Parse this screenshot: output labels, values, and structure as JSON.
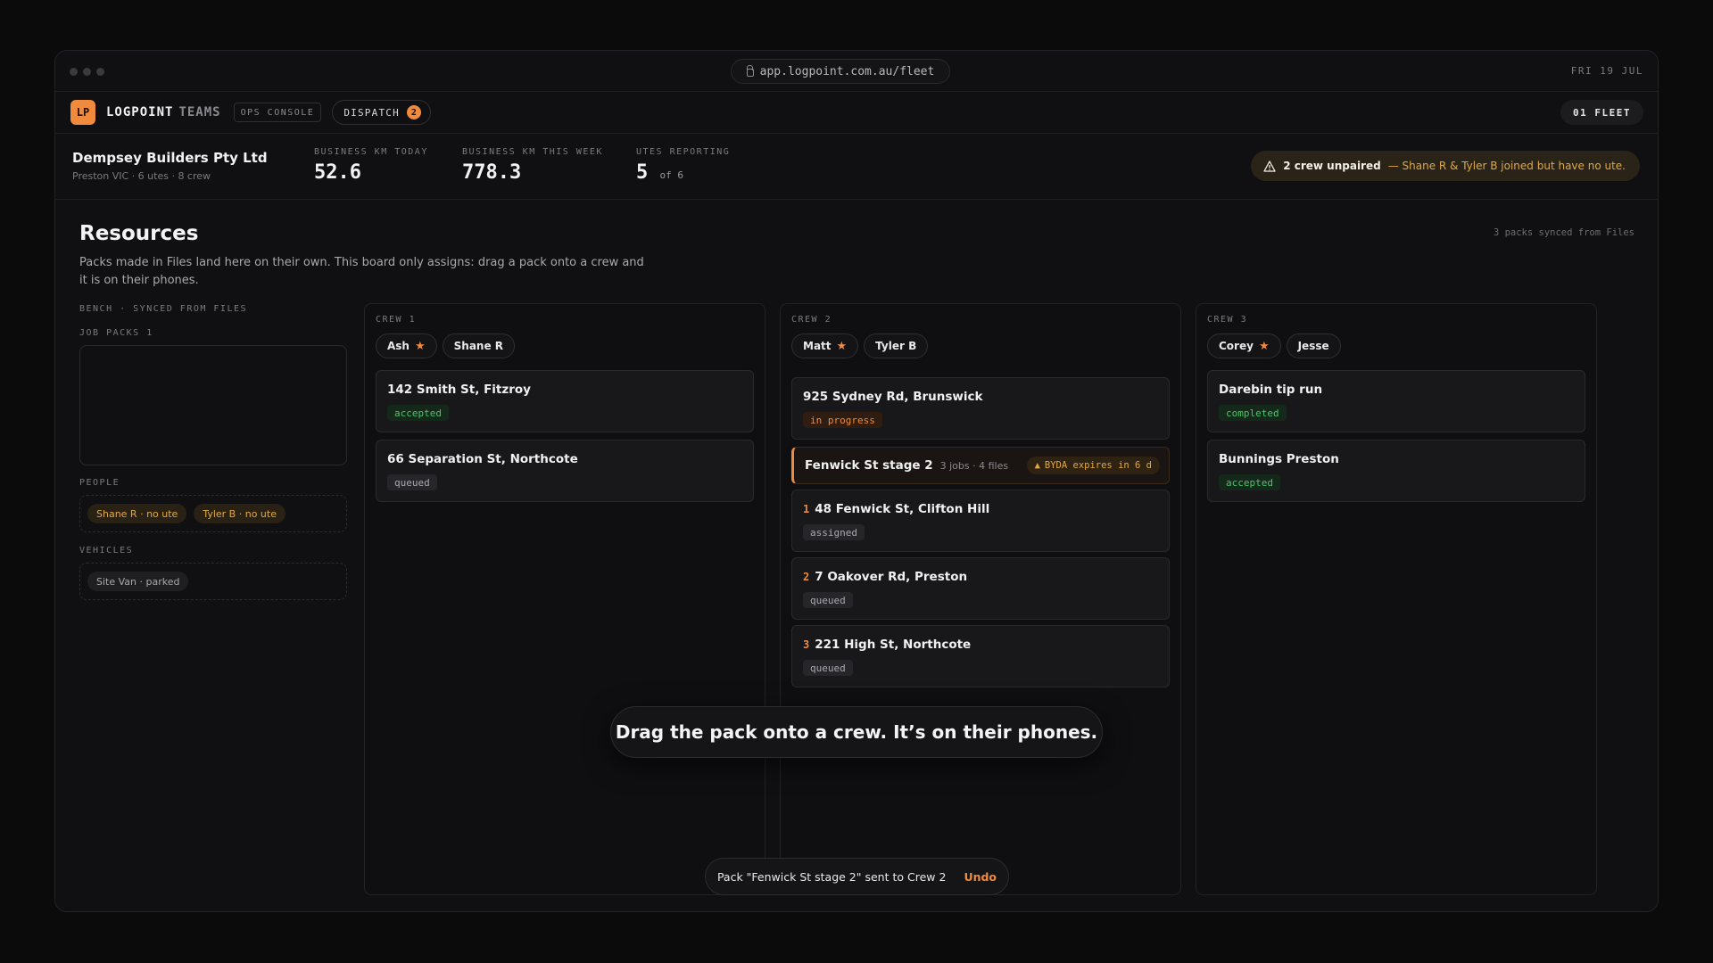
{
  "window": {
    "url": "app.logpoint.com.au/fleet",
    "date": "FRI 19 JUL"
  },
  "appbar": {
    "logo": "LP",
    "brand": "LOGPOINT",
    "brand_sub": "TEAMS",
    "ops_console": "OPS CONSOLE",
    "dispatch_label": "DISPATCH",
    "dispatch_count": "2",
    "fleet": "01 FLEET"
  },
  "company": {
    "name": "Dempsey Builders Pty Ltd",
    "sub": "Preston VIC · 6 utes · 8 crew"
  },
  "stats": [
    {
      "label": "BUSINESS KM TODAY",
      "value": "52.6"
    },
    {
      "label": "BUSINESS KM THIS WEEK",
      "value": "778.3"
    },
    {
      "label": "UTES REPORTING",
      "value": "5",
      "suffix": "of 6"
    }
  ],
  "alert": {
    "strong": "2 crew unpaired",
    "rest": "— Shane R & Tyler B joined but have no ute."
  },
  "resources": {
    "title": "Resources",
    "description": "Packs made in Files land here on their own. This board only assigns: drag a pack onto a crew and it is on their phones.",
    "synced": "3 packs synced from Files"
  },
  "bench": {
    "label": "BENCH · SYNCED FROM FILES",
    "job_packs_label": "JOB PACKS 1",
    "people_label": "PEOPLE",
    "people": [
      "Shane R · no ute",
      "Tyler B · no ute"
    ],
    "vehicles_label": "VEHICLES",
    "vehicles": [
      "Site Van · parked"
    ]
  },
  "crews": [
    {
      "label": "CREW 1",
      "members": [
        {
          "name": "Ash",
          "lead": true
        },
        {
          "name": "Shane R",
          "lead": false
        }
      ],
      "jobs": [
        {
          "title": "142 Smith St, Fitzroy",
          "status": "accepted"
        },
        {
          "title": "66 Separation St, Northcote",
          "status": "queued"
        }
      ]
    },
    {
      "label": "CREW 2",
      "members": [
        {
          "name": "Matt",
          "lead": true
        },
        {
          "name": "Tyler B",
          "lead": false
        }
      ],
      "jobs": [
        {
          "title": "925 Sydney Rd, Brunswick",
          "status": "in progress"
        }
      ],
      "pack": {
        "title": "Fenwick St stage 2",
        "meta": "3 jobs · 4 files",
        "flag": "BYDA expires in 6 d",
        "jobs": [
          {
            "num": "1",
            "title": "48 Fenwick St, Clifton Hill",
            "status": "assigned"
          },
          {
            "num": "2",
            "title": "7 Oakover Rd, Preston",
            "status": "queued"
          },
          {
            "num": "3",
            "title": "221 High St, Northcote",
            "status": "queued"
          }
        ]
      }
    },
    {
      "label": "CREW 3",
      "members": [
        {
          "name": "Corey",
          "lead": true
        },
        {
          "name": "Jesse",
          "lead": false
        }
      ],
      "jobs": [
        {
          "title": "Darebin tip run",
          "status": "completed"
        },
        {
          "title": "Bunnings Preston",
          "status": "accepted"
        }
      ]
    }
  ],
  "hint": "Drag the pack onto a crew. It’s on their phones.",
  "toast": {
    "message": "Pack \"Fenwick St stage 2\" sent to Crew 2",
    "action": "Undo"
  },
  "colors": {
    "accent": "#f08a3c",
    "success": "#4cc36a",
    "warning": "#e0a845"
  }
}
